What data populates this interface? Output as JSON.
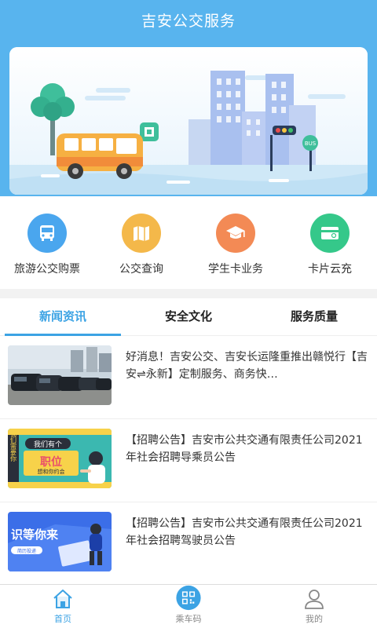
{
  "header": {
    "title": "吉安公交服务"
  },
  "banner": {
    "bus_sign": "BUS"
  },
  "services": [
    {
      "label": "旅游公交购票",
      "icon": "bus-icon",
      "color": "#4aa6ee"
    },
    {
      "label": "公交查询",
      "icon": "map-icon",
      "color": "#f4b84a"
    },
    {
      "label": "学生卡业务",
      "icon": "graduation-cap-icon",
      "color": "#f38a55"
    },
    {
      "label": "卡片云充",
      "icon": "card-icon",
      "color": "#35c88a"
    }
  ],
  "tabs": [
    {
      "label": "新闻资讯",
      "active": true
    },
    {
      "label": "安全文化",
      "active": false
    },
    {
      "label": "服务质量",
      "active": false
    }
  ],
  "news": [
    {
      "text": "好消息！吉安公交、吉安长运隆重推出赣悦行【吉安⇌永新】定制服务、商务快…"
    },
    {
      "text": "【招聘公告】吉安市公共交通有限责任公司2021年社会招聘导乘员公告",
      "thumb_texts": {
        "side": "我们需要你",
        "bubble": "我们有个",
        "big": "职位",
        "sub": "想和你约会"
      }
    },
    {
      "text": "【招聘公告】吉安市公共交通有限责任公司2021年社会招聘驾驶员公告",
      "thumb_texts": {
        "main": "识等你来",
        "button": "简历投递"
      }
    }
  ],
  "bottom_nav": [
    {
      "label": "首页",
      "icon": "home-icon",
      "active": true
    },
    {
      "label": "乘车码",
      "icon": "qr-code-icon",
      "active": false
    },
    {
      "label": "我的",
      "icon": "user-icon",
      "active": false
    }
  ],
  "colors": {
    "primary": "#58b4ee",
    "active": "#3ca3e4"
  }
}
